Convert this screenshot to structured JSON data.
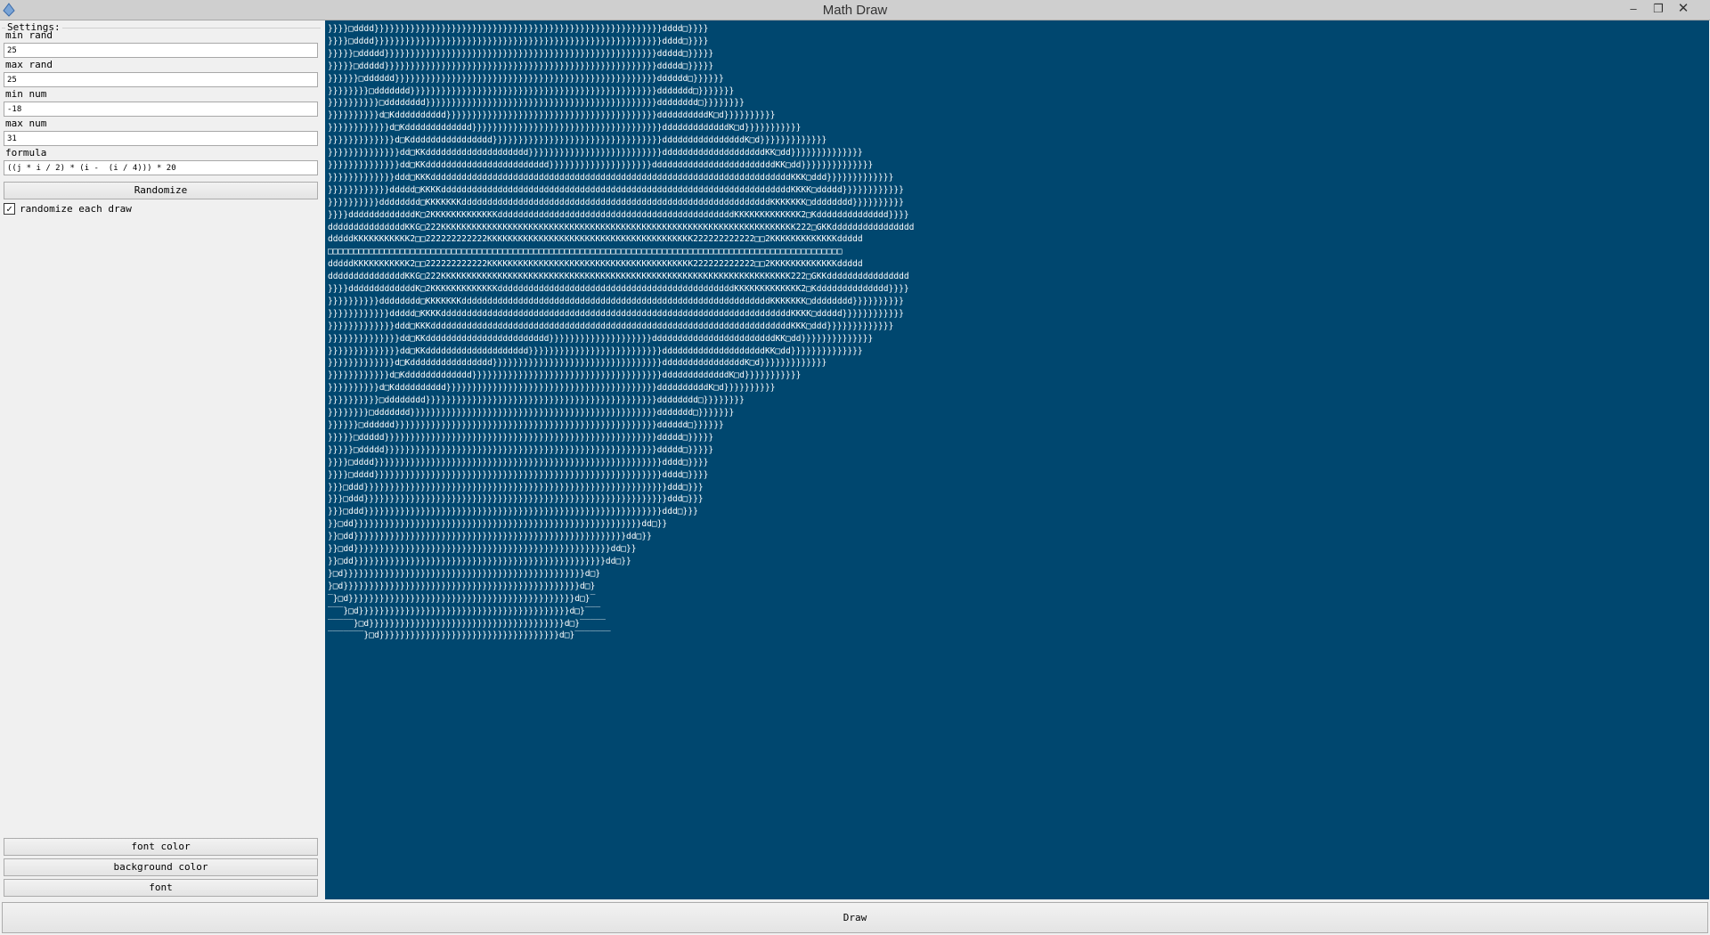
{
  "window": {
    "title": "Math Draw",
    "controls": {
      "minimize": "–",
      "maximize": "❐",
      "close": "✕"
    }
  },
  "settings": {
    "legend": "Settings:",
    "min_rand": {
      "label": "min rand",
      "value": "25"
    },
    "max_rand": {
      "label": "max rand",
      "value": "25"
    },
    "min_num": {
      "label": "min num",
      "value": "-18"
    },
    "max_num": {
      "label": "max num",
      "value": "31"
    },
    "formula": {
      "label": "formula",
      "value": "((j * i / 2) * (i -  (i / 4))) * 20"
    },
    "randomize_button": "Randomize",
    "randomize_each_draw": {
      "label": "randomize each draw",
      "checked": true,
      "check_glyph": "✓"
    },
    "font_color_button": "font color",
    "background_color_button": "background color",
    "font_button": "font"
  },
  "canvas": {
    "background_color": "#00476f",
    "font_color": "#ffffff",
    "lines": [
      "}}}}□dddd}}}}}}}}}}}}}}}}}}}}}}}}}}}}}}}}}}}}}}}}}}}}}}}}}}}}}}}}dddd□}}}}",
      "}}}}□dddd}}}}}}}}}}}}}}}}}}}}}}}}}}}}}}}}}}}}}}}}}}}}}}}}}}}}}}}}dddd□}}}}",
      "}}}}}□ddddd}}}}}}}}}}}}}}}}}}}}}}}}}}}}}}}}}}}}}}}}}}}}}}}}}}}}}ddddd□}}}}}",
      "}}}}}□ddddd}}}}}}}}}}}}}}}}}}}}}}}}}}}}}}}}}}}}}}}}}}}}}}}}}}}}}ddddd□}}}}}",
      "}}}}}}□dddddd}}}}}}}}}}}}}}}}}}}}}}}}}}}}}}}}}}}}}}}}}}}}}}}}}}}dddddd□}}}}}}",
      "}}}}}}}}□ddddddd}}}}}}}}}}}}}}}}}}}}}}}}}}}}}}}}}}}}}}}}}}}}}}}}ddddddd□}}}}}}}",
      "}}}}}}}}}}□dddddddd}}}}}}}}}}}}}}}}}}}}}}}}}}}}}}}}}}}}}}}}}}}}}dddddddd□}}}}}}}}",
      "}}}}}}}}}}d□Kdddddddddd}}}}}}}}}}}}}}}}}}}}}}}}}}}}}}}}}}}}}}}}}ddddddddddK□d}}}}}}}}}}",
      "}}}}}}}}}}}}d□Kddddddddddddd}}}}}}}}}}}}}}}}}}}}}}}}}}}}}}}}}}}}}dddddddddddddK□d}}}}}}}}}}}",
      "}}}}}}}}}}}}}d□Kdddddddddddddddd}}}}}}}}}}}}}}}}}}}}}}}}}}}}}}}}}ddddddddddddddddK□d}}}}}}}}}}}}}",
      "}}}}}}}}}}}}}}dd□KKdddddddddddddddddddd}}}}}}}}}}}}}}}}}}}}}}}}}}ddddddddddddddddddddKK□dd}}}}}}}}}}}}}}",
      "}}}}}}}}}}}}}}dd□KKdddddddddddddddddddddddd}}}}}}}}}}}}}}}}}}}}ddddddddddddddddddddddddKK□dd}}}}}}}}}}}}}}",
      "}}}}}}}}}}}}}ddd□KKKddddddddddddddddddddddddddddddddddddddddddddddddddddddddddddddddddddddKKK□ddd}}}}}}}}}}}}}",
      "}}}}}}}}}}}}ddddd□KKKKddddddddddddddddddddddddddddddddddddddddddddddddddddddddddddddddddddKKKK□ddddd}}}}}}}}}}}}",
      "}}}}}}}}}}dddddddd□KKKKKKKddddddddddddddddddddddddddddddddddddddddddddddddddddddddddddKKKKKKK□dddddddd}}}}}}}}}}",
      "}}}}dddddddddddddK□2KKKKKKKKKKKKKddddddddddddddddddddddddddddddddddddddddddddddKKKKKKKKKKKKK2□Kdddddddddddddd}}}}",
      "dddddddddddddddKKG□222KKKKKKKKKKKKKKKKKKKKKKKKKKKKKKKKKKKKKKKKKKKKKKKKKKKKKKKKKKKKKKKKKKKKK222□GKKdddddddddddddddd",
      "dddddKKKKKKKKKKK2□□222222222222KKKKKKKKKKKKKKKKKKKKKKKKKKKKKKKKKKKKKKKK222222222222□□2KKKKKKKKKKKKKddddd",
      "□□□□□□□□□□□□□□□□□□□□□□□□□□□□□□□□□□□□□□□□□□□□□□□□□□□□□□□□□□□□□□□□□□□□□□□□□□□□□□□□□□□□□□□□□□□□□□□□□□□□",
      "dddddKKKKKKKKKKK2□□222222222222KKKKKKKKKKKKKKKKKKKKKKKKKKKKKKKKKKKKKKKK222222222222□□2KKKKKKKKKKKKKddddd",
      "dddddddddddddddKKG□222KKKKKKKKKKKKKKKKKKKKKKKKKKKKKKKKKKKKKKKKKKKKKKKKKKKKKKKKKKKKKKKKKKKK222□GKKdddddddddddddddd",
      "}}}}dddddddddddddK□2KKKKKKKKKKKKKddddddddddddddddddddddddddddddddddddddddddddddKKKKKKKKKKKKK2□Kdddddddddddddd}}}}",
      "}}}}}}}}}}dddddddd□KKKKKKKddddddddddddddddddddddddddddddddddddddddddddddddddddddddddddKKKKKKK□dddddddd}}}}}}}}}}",
      "}}}}}}}}}}}}ddddd□KKKKddddddddddddddddddddddddddddddddddddddddddddddddddddddddddddddddddddKKKK□ddddd}}}}}}}}}}}}",
      "}}}}}}}}}}}}}ddd□KKKddddddddddddddddddddddddddddddddddddddddddddddddddddddddddddddddddddddKKK□ddd}}}}}}}}}}}}}",
      "}}}}}}}}}}}}}}dd□KKdddddddddddddddddddddddd}}}}}}}}}}}}}}}}}}}}ddddddddddddddddddddddddKK□dd}}}}}}}}}}}}}}",
      "}}}}}}}}}}}}}}dd□KKdddddddddddddddddddd}}}}}}}}}}}}}}}}}}}}}}}}}}ddddddddddddddddddddKK□dd}}}}}}}}}}}}}}",
      "}}}}}}}}}}}}}d□Kdddddddddddddddd}}}}}}}}}}}}}}}}}}}}}}}}}}}}}}}}}ddddddddddddddddK□d}}}}}}}}}}}}}",
      "}}}}}}}}}}}}d□Kddddddddddddd}}}}}}}}}}}}}}}}}}}}}}}}}}}}}}}}}}}}}dddddddddddddK□d}}}}}}}}}}}",
      "}}}}}}}}}}d□Kdddddddddd}}}}}}}}}}}}}}}}}}}}}}}}}}}}}}}}}}}}}}}}}ddddddddddK□d}}}}}}}}}}",
      "}}}}}}}}}}□dddddddd}}}}}}}}}}}}}}}}}}}}}}}}}}}}}}}}}}}}}}}}}}}}}dddddddd□}}}}}}}}",
      "}}}}}}}}□ddddddd}}}}}}}}}}}}}}}}}}}}}}}}}}}}}}}}}}}}}}}}}}}}}}}}ddddddd□}}}}}}}",
      "}}}}}}□dddddd}}}}}}}}}}}}}}}}}}}}}}}}}}}}}}}}}}}}}}}}}}}}}}}}}}}dddddd□}}}}}}",
      "}}}}}□ddddd}}}}}}}}}}}}}}}}}}}}}}}}}}}}}}}}}}}}}}}}}}}}}}}}}}}}}ddddd□}}}}}",
      "}}}}}□ddddd}}}}}}}}}}}}}}}}}}}}}}}}}}}}}}}}}}}}}}}}}}}}}}}}}}}}}ddddd□}}}}}",
      "}}}}□dddd}}}}}}}}}}}}}}}}}}}}}}}}}}}}}}}}}}}}}}}}}}}}}}}}}}}}}}}}dddd□}}}}",
      "}}}}□dddd}}}}}}}}}}}}}}}}}}}}}}}}}}}}}}}}}}}}}}}}}}}}}}}}}}}}}}}}dddd□}}}}",
      "}}}□ddd}}}}}}}}}}}}}}}}}}}}}}}}}}}}}}}}}}}}}}}}}}}}}}}}}}}}}}}}}}}ddd□}}}",
      "}}}□ddd}}}}}}}}}}}}}}}}}}}}}}}}}}}}}}}}}}}}}}}}}}}}}}}}}}}}}}}}}}}ddd□}}}",
      "}}}□ddd}}}}}}}}}}}}}}}}}}}}}}}}}}}}}}}}}}}}}}}}}}}}}}}}}}}}}}}}}}ddd□}}}",
      "}}□dd}}}}}}}}}}}}}}}}}}}}}}}}}}}}}}}}}}}}}}}}}}}}}}}}}}}}}}}}dd□}}",
      "}}□dd}}}}}}}}}}}}}}}}}}}}}}}}}}}}}}}}}}}}}}}}}}}}}}}}}}}}}dd□}}",
      "}}□dd}}}}}}}}}}}}}}}}}}}}}}}}}}}}}}}}}}}}}}}}}}}}}}}}}}dd□}}",
      "}}□dd}}}}}}}}}}}}}}}}}}}}}}}}}}}}}}}}}}}}}}}}}}}}}}}}}dd□}}",
      "}□d}}}}}}}}}}}}}}}}}}}}}}}}}}}}}}}}}}}}}}}}}}}}}}}d□}",
      "}□d}}}}}}}}}}}}}}}}}}}}}}}}}}}}}}}}}}}}}}}}}}}}}}d□}",
      "‾}□d}}}}}}}}}}}}}}}}}}}}}}}}}}}}}}}}}}}}}}}}}}}}d□}‾",
      "‾‾‾}□d}}}}}}}}}}}}}}}}}}}}}}}}}}}}}}}}}}}}}}}}}d□}‾‾‾",
      "‾‾‾‾‾}□d}}}}}}}}}}}}}}}}}}}}}}}}}}}}}}}}}}}}}}d□}‾‾‾‾‾",
      "‾‾‾‾‾‾‾}□d}}}}}}}}}}}}}}}}}}}}}}}}}}}}}}}}}}}d□}‾‾‾‾‾‾‾"
    ]
  },
  "draw_button": "Draw"
}
